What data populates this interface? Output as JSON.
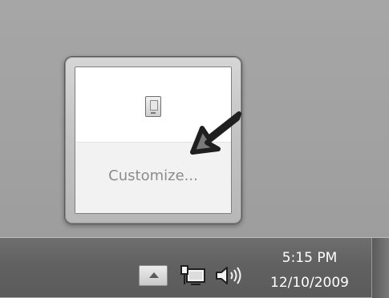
{
  "popup": {
    "icons": [
      {
        "name": "removable-device-icon"
      }
    ],
    "customize_label": "Customize..."
  },
  "taskbar": {
    "tray_icons": [
      "show-hidden-icons",
      "network-icon",
      "volume-icon"
    ],
    "clock": {
      "time": "5:15 PM",
      "date": "12/10/2009"
    }
  }
}
